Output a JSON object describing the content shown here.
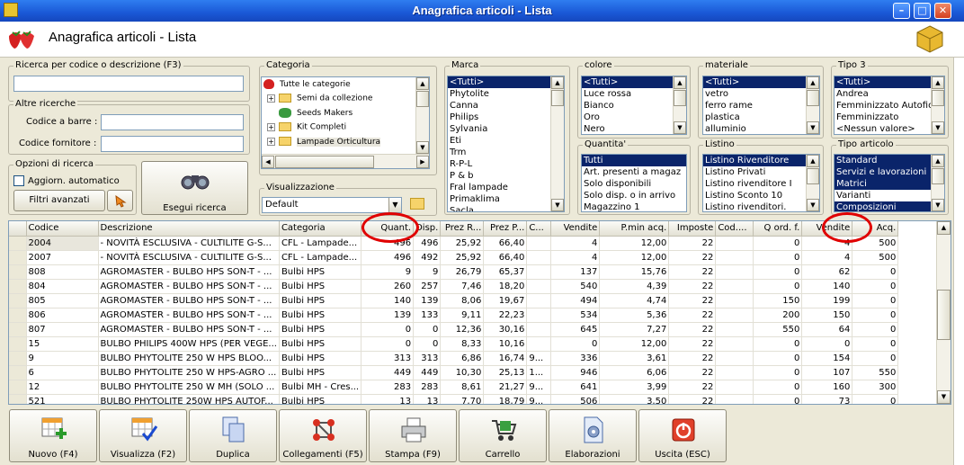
{
  "window": {
    "title": "Anagrafica articoli  - Lista"
  },
  "header": {
    "title": "Anagrafica articoli  - Lista"
  },
  "search": {
    "group_label": "Ricerca per codice o descrizione (F3)",
    "value": "",
    "other_label": "Altre ricerche",
    "barcode_label": "Codice a barre :",
    "supplier_label": "Codice fornitore :",
    "options_label": "Opzioni di ricerca",
    "auto_update_label": "Aggiorn. automatico",
    "advanced_filters_label": "Filtri avanzati",
    "execute_label": "Esegui ricerca"
  },
  "categoria": {
    "label": "Categoria",
    "items": [
      "Tutte le categorie",
      "Semi da collezione",
      "Seeds Makers",
      "Kit Completi",
      "Lampade Orticultura"
    ]
  },
  "visualizzazione": {
    "label": "Visualizzazione",
    "value": "Default"
  },
  "marca": {
    "label": "Marca",
    "items": [
      "<Tutti>",
      "Phytolite",
      "Canna",
      "Philips",
      "Sylvania",
      "Eti",
      "Trm",
      "R-P-L",
      "P & b",
      "Fral lampade",
      "Primaklima",
      "Sacla"
    ]
  },
  "colore": {
    "label": "colore",
    "items": [
      "<Tutti>",
      "Luce rossa",
      "Bianco",
      "Oro",
      "Nero"
    ]
  },
  "materiale": {
    "label": "materiale",
    "items": [
      "<Tutti>",
      "vetro",
      "ferro rame",
      "plastica",
      "alluminio"
    ]
  },
  "tipo3": {
    "label": "Tipo 3",
    "items": [
      "<Tutti>",
      "Andrea",
      "Femminizzato Autofior",
      "Femminizzato",
      "<Nessun valore>"
    ]
  },
  "quantita": {
    "label": "Quantita'",
    "items": [
      "Tutti",
      "Art. presenti a magaz",
      "Solo disponibili",
      "Solo disp. o in arrivo",
      "Magazzino 1"
    ]
  },
  "listino": {
    "label": "Listino",
    "items": [
      "Listino Rivenditore",
      "Listino Privati",
      "Listino rivenditore I",
      "Listino Sconto 10",
      "Listino rivenditori."
    ]
  },
  "tipo_articolo": {
    "label": "Tipo articolo",
    "items": [
      "Standard",
      "Servizi e lavorazioni",
      "Matrici",
      "Varianti",
      "Composizioni"
    ]
  },
  "grid": {
    "columns": [
      "Codice",
      "Descrizione",
      "Categoria",
      "Quant.",
      "Disp.",
      "Prez R...",
      "Prez P...",
      "C...",
      "Vendite",
      "P.min acq.",
      "Imposte",
      "Cod....",
      "Q ord. f.",
      "Vendite",
      "Acq."
    ],
    "rows": [
      [
        "2004",
        "- NOVITÀ ESCLUSIVA - CULTILITE G-S...",
        "CFL - Lampade...",
        "496",
        "496",
        "25,92",
        "66,40",
        "",
        "4",
        "12,00",
        "22",
        "",
        "0",
        "4",
        "500"
      ],
      [
        "2007",
        "- NOVITÀ ESCLUSIVA - CULTILITE G-S...",
        "CFL - Lampade...",
        "496",
        "492",
        "25,92",
        "66,40",
        "",
        "4",
        "12,00",
        "22",
        "",
        "0",
        "4",
        "500"
      ],
      [
        "808",
        "AGROMASTER - BULBO HPS SON-T - ...",
        "Bulbi HPS",
        "9",
        "9",
        "26,79",
        "65,37",
        "",
        "137",
        "15,76",
        "22",
        "",
        "0",
        "62",
        "0"
      ],
      [
        "804",
        "AGROMASTER - BULBO HPS SON-T - ...",
        "Bulbi HPS",
        "260",
        "257",
        "7,46",
        "18,20",
        "",
        "540",
        "4,39",
        "22",
        "",
        "0",
        "140",
        "0"
      ],
      [
        "805",
        "AGROMASTER - BULBO HPS SON-T - ...",
        "Bulbi HPS",
        "140",
        "139",
        "8,06",
        "19,67",
        "",
        "494",
        "4,74",
        "22",
        "",
        "150",
        "199",
        "0"
      ],
      [
        "806",
        "AGROMASTER - BULBO HPS SON-T - ...",
        "Bulbi HPS",
        "139",
        "133",
        "9,11",
        "22,23",
        "",
        "534",
        "5,36",
        "22",
        "",
        "200",
        "150",
        "0"
      ],
      [
        "807",
        "AGROMASTER - BULBO HPS SON-T - ...",
        "Bulbi HPS",
        "0",
        "0",
        "12,36",
        "30,16",
        "",
        "645",
        "7,27",
        "22",
        "",
        "550",
        "64",
        "0"
      ],
      [
        "15",
        "BULBO PHILIPS 400W HPS (PER VEGE...",
        "Bulbi HPS",
        "0",
        "0",
        "8,33",
        "10,16",
        "",
        "0",
        "12,00",
        "22",
        "",
        "0",
        "0",
        "0"
      ],
      [
        "9",
        "BULBO PHYTOLITE 250 W HPS BLOO...",
        "Bulbi HPS",
        "313",
        "313",
        "6,86",
        "16,74",
        "9...",
        "336",
        "3,61",
        "22",
        "",
        "0",
        "154",
        "0"
      ],
      [
        "6",
        "BULBO PHYTOLITE 250 W HPS-AGRO ...",
        "Bulbi HPS",
        "449",
        "449",
        "10,30",
        "25,13",
        "1...",
        "946",
        "6,06",
        "22",
        "",
        "0",
        "107",
        "550"
      ],
      [
        "12",
        "BULBO PHYTOLITE 250 W MH (SOLO ...",
        "Bulbi MH - Cres...",
        "283",
        "283",
        "8,61",
        "21,27",
        "9...",
        "641",
        "3,99",
        "22",
        "",
        "0",
        "160",
        "300"
      ],
      [
        "521",
        "BULBO PHYTOLITE 250W HPS AUTOF...",
        "Bulbi HPS",
        "13",
        "13",
        "7,70",
        "18,79",
        "9...",
        "506",
        "3,50",
        "22",
        "",
        "0",
        "73",
        "0"
      ]
    ]
  },
  "toolbar": {
    "new_label": "Nuovo (F4)",
    "view_label": "Visualizza (F2)",
    "duplicate_label": "Duplica",
    "links_label": "Collegamenti (F5)",
    "print_label": "Stampa (F9)",
    "cart_label": "Carrello",
    "processing_label": "Elaborazioni",
    "exit_label": "Uscita (ESC)"
  },
  "colors": {
    "titlebar": "#1a58d6",
    "selection": "#0a246a",
    "annotation": "#e00000"
  }
}
